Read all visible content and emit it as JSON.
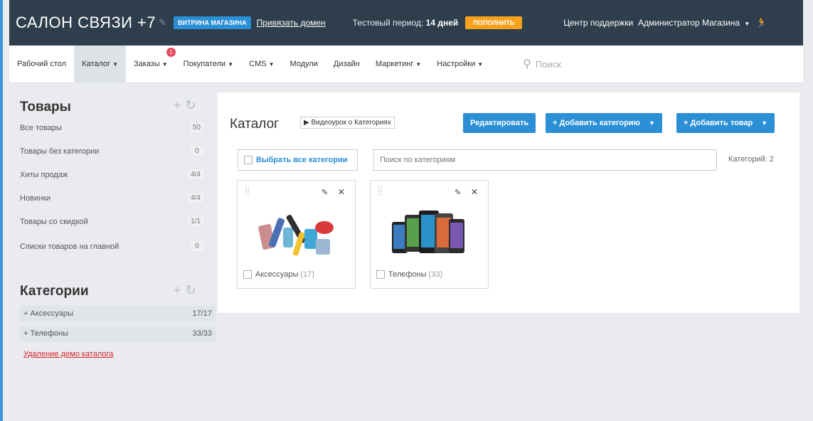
{
  "colors": {
    "topbar": "#2e3e4c",
    "accent_blue": "#2b8fd6",
    "accent_orange": "#f7a21c",
    "badge_red": "#e84b60",
    "link_red": "#d9262b"
  },
  "topbar": {
    "store_name": "САЛОН СВЯЗИ +7",
    "storefront_btn": "ВИТРИНА МАГАЗИНА",
    "bind_domain": "Привязать домен",
    "trial_label": "Тестовый период:",
    "trial_days": "14 дней",
    "topup_btn": "ПОПОЛНИТЬ",
    "support": "Центр поддержки",
    "admin": "Администратор Магазина",
    "icons": {
      "edit": "pencil-icon",
      "user": "runner-icon"
    }
  },
  "nav": {
    "items": [
      {
        "label": "Рабочий стол"
      },
      {
        "label": "Каталог"
      },
      {
        "label": "Заказы"
      },
      {
        "label": "Покупатели"
      },
      {
        "label": "CMS"
      },
      {
        "label": "Модули"
      },
      {
        "label": "Дизайн"
      },
      {
        "label": "Маркетинг"
      },
      {
        "label": "Настройки"
      }
    ],
    "orders_badge": "1",
    "search_placeholder": "Поиск"
  },
  "sidebar": {
    "products_title": "Товары",
    "products": [
      {
        "label": "Все товары",
        "count": "50"
      },
      {
        "label": "Товары без категории",
        "count": "0"
      },
      {
        "label": "Хиты продаж",
        "count": "4/4"
      },
      {
        "label": "Новинки",
        "count": "4/4"
      },
      {
        "label": "Товары со скидкой",
        "count": "1/1"
      },
      {
        "label": "Списки товаров на главной",
        "count": "0"
      }
    ],
    "categories_title": "Категории",
    "categories": [
      {
        "label": "Аксессуары",
        "count": "17/17"
      },
      {
        "label": "Телефоны",
        "count": "33/33"
      }
    ],
    "demo_link": "Удаление демо каталога"
  },
  "main": {
    "title": "Каталог",
    "video_btn": "Видеоурок о Категориях",
    "edit_btn": "Редактировать",
    "add_category_btn": "Добавить категорию",
    "add_product_btn": "Добавить товар",
    "select_all": "Выбрать все категории",
    "search_placeholder": "Поиск по категориям",
    "category_count": "Категорий: 2",
    "cards": [
      {
        "name": "Аксессуары",
        "count": "(17)"
      },
      {
        "name": "Телефоны",
        "count": "(33)"
      }
    ]
  }
}
